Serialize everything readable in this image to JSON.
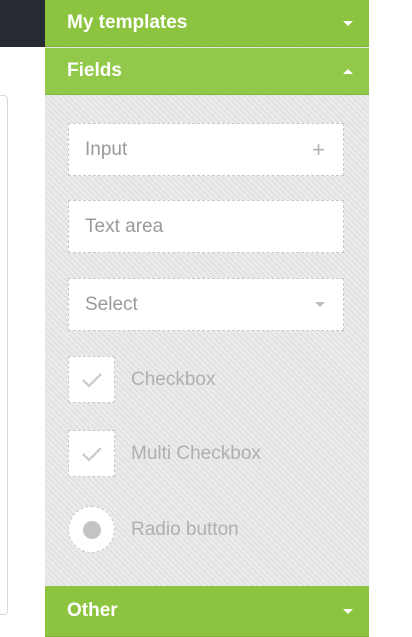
{
  "sidebar": {
    "groups": {
      "my_templates": {
        "label": "My templates",
        "state": "collapsed"
      },
      "fields": {
        "label": "Fields",
        "state": "expanded"
      },
      "other": {
        "label": "Other",
        "state": "collapsed"
      }
    },
    "fields": {
      "input": {
        "label": "Input",
        "action_icon": "+"
      },
      "textarea": {
        "label": "Text area"
      },
      "select": {
        "label": "Select"
      },
      "checkbox": {
        "label": "Checkbox"
      },
      "multi_checkbox": {
        "label": "Multi Checkbox"
      },
      "radio": {
        "label": "Radio button"
      }
    }
  },
  "colors": {
    "header_green": "#8cc43f",
    "panel_bg": "#e6e6e6",
    "topbar_dark": "#262b34"
  }
}
